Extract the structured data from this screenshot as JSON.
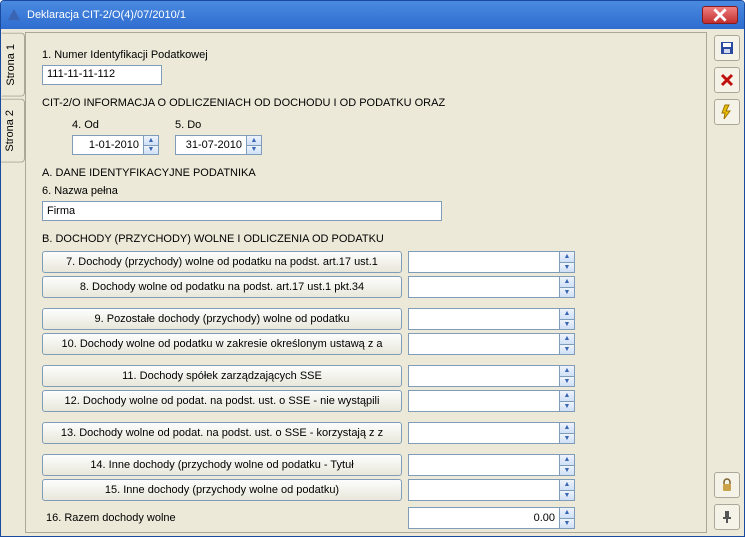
{
  "window": {
    "title": "Deklaracja CIT-2/O(4)/07/2010/1"
  },
  "tabs": {
    "page1": "Strona 1",
    "page2": "Strona 2"
  },
  "field1": {
    "label": "1. Numer Identyfikacji Podatkowej",
    "value": "111-11-11-112"
  },
  "header2": "CIT-2/O  INFORMACJA O ODLICZENIACH OD DOCHODU I OD PODATKU ORAZ",
  "dates": {
    "from_label": "4. Od",
    "from_value": "1-01-2010",
    "to_label": "5. Do",
    "to_value": "31-07-2010"
  },
  "sectionA": {
    "title": "A. DANE IDENTYFIKACYJNE PODATNIKA",
    "field6_label": "6. Nazwa pełna",
    "field6_value": "Firma"
  },
  "sectionB": {
    "title": "B. DOCHODY (PRZYCHODY) WOLNE I ODLICZENIA OD PODATKU",
    "rows": [
      {
        "label": "7. Dochody (przychody) wolne od podatku na podst. art.17 ust.1",
        "value": ""
      },
      {
        "label": "8. Dochody wolne od podatku na podst. art.17 ust.1 pkt.34",
        "value": ""
      },
      {
        "label": "9. Pozostałe dochody (przychody) wolne od podatku",
        "value": ""
      },
      {
        "label": "10. Dochody wolne od podatku w zakresie określonym ustawą z a",
        "value": ""
      },
      {
        "label": "11. Dochody spółek zarządzających SSE",
        "value": ""
      },
      {
        "label": "12. Dochody wolne od podat. na podst. ust. o SSE - nie wystąpili",
        "value": ""
      },
      {
        "label": "13. Dochody wolne od podat. na podst. ust. o SSE - korzystają z z",
        "value": ""
      },
      {
        "label": "14. Inne dochody (przychody wolne od podatku - Tytuł",
        "value": ""
      },
      {
        "label": "15. Inne dochody (przychody wolne od podatku)",
        "value": ""
      }
    ],
    "sum_label": "16. Razem dochody wolne",
    "sum_value": "0.00"
  }
}
